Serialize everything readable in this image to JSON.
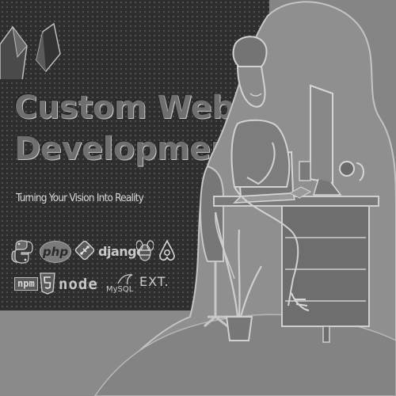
{
  "hero": {
    "title_line_1": "Custom Web",
    "title_line_2": "Development",
    "tagline": "Turning Your Vision Into Reality"
  },
  "tech_stack": {
    "php": "php",
    "django": "django",
    "npm": "npm",
    "node": "node",
    "mysql": "MySQL",
    "ext": "EXT."
  },
  "icons": {
    "logo": "crystal-logo-icon",
    "python": "python-icon",
    "php": "php-icon",
    "git": "git-icon",
    "django": "django-icon",
    "bee": "bee-icon",
    "airbnb": "airbnb-icon",
    "npm": "npm-icon",
    "html5": "html5-icon",
    "node": "node-icon",
    "mysql": "mysql-icon",
    "ext": "ext-icon"
  },
  "colors": {
    "dark_panel": "#2e2e2e",
    "background": "#858585",
    "headline": "#6f6f6f",
    "tagline": "#d8d8d8"
  }
}
